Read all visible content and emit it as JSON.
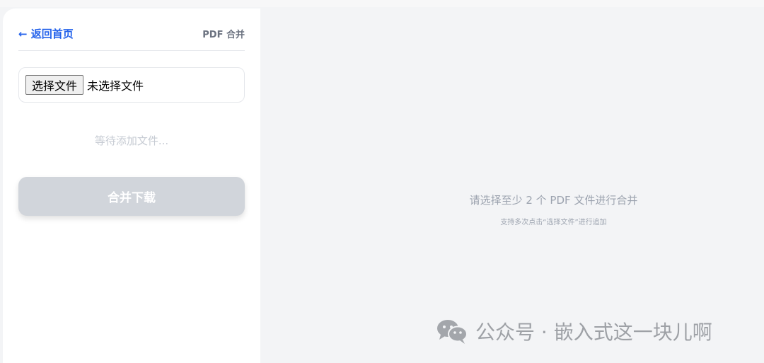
{
  "sidebar": {
    "back_label": "← 返回首页",
    "title": "PDF 合并",
    "file_input": {
      "button_label": "选择文件",
      "status": "未选择文件"
    },
    "waiting_text": "等待添加文件...",
    "merge_button": "合并下载"
  },
  "main": {
    "hint_title": "请选择至少 2 个 PDF 文件进行合并",
    "hint_subtitle": "支持多次点击“选择文件”进行追加"
  },
  "watermark": {
    "text": "公众号 · 嵌入式这一块儿啊",
    "icon": "wechat-icon"
  },
  "colors": {
    "accent": "#2563eb",
    "background": "#f3f4f6",
    "disabled_button": "#d1d5db"
  }
}
